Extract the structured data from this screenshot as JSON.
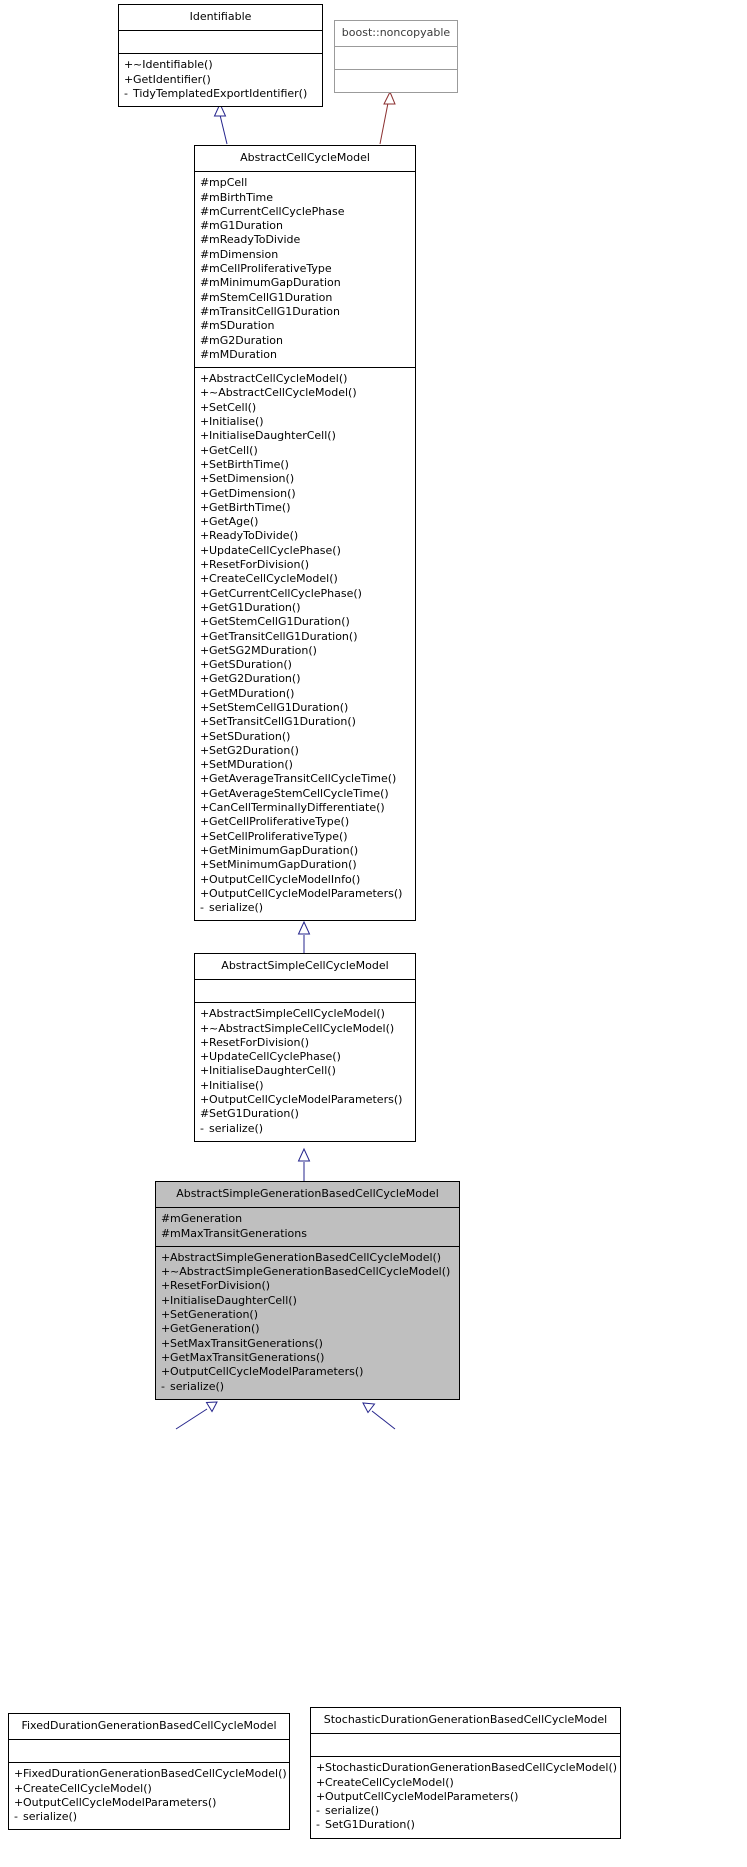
{
  "diagram": {
    "type": "uml-class-inheritance",
    "title": "AbstractSimpleGenerationBasedCellCycleModel inheritance diagram",
    "colors": {
      "highlight_fill": "#bfbfbf",
      "box_border": "#000000",
      "faded_border": "#9b9b9b",
      "inherit_edge": "#25258c",
      "external_edge": "#8b2f2f",
      "background": "#ffffff"
    }
  },
  "classes": {
    "identifiable": {
      "name": "Identifiable",
      "attributes": [],
      "methods": [
        {
          "vis": "+",
          "text": "~Identifiable()"
        },
        {
          "vis": "+",
          "text": "GetIdentifier()"
        },
        {
          "vis": "-",
          "text": "TidyTemplatedExportIdentifier()"
        }
      ]
    },
    "noncopyable": {
      "name": "boost::noncopyable",
      "attributes": [],
      "methods": []
    },
    "abstract_cell_cycle_model": {
      "name": "AbstractCellCycleModel",
      "attributes": [
        {
          "vis": "#",
          "text": "mpCell"
        },
        {
          "vis": "#",
          "text": "mBirthTime"
        },
        {
          "vis": "#",
          "text": "mCurrentCellCyclePhase"
        },
        {
          "vis": "#",
          "text": "mG1Duration"
        },
        {
          "vis": "#",
          "text": "mReadyToDivide"
        },
        {
          "vis": "#",
          "text": "mDimension"
        },
        {
          "vis": "#",
          "text": "mCellProliferativeType"
        },
        {
          "vis": "#",
          "text": "mMinimumGapDuration"
        },
        {
          "vis": "#",
          "text": "mStemCellG1Duration"
        },
        {
          "vis": "#",
          "text": "mTransitCellG1Duration"
        },
        {
          "vis": "#",
          "text": "mSDuration"
        },
        {
          "vis": "#",
          "text": "mG2Duration"
        },
        {
          "vis": "#",
          "text": "mMDuration"
        }
      ],
      "methods": [
        {
          "vis": "+",
          "text": "AbstractCellCycleModel()"
        },
        {
          "vis": "+",
          "text": "~AbstractCellCycleModel()"
        },
        {
          "vis": "+",
          "text": "SetCell()"
        },
        {
          "vis": "+",
          "text": "Initialise()"
        },
        {
          "vis": "+",
          "text": "InitialiseDaughterCell()"
        },
        {
          "vis": "+",
          "text": "GetCell()"
        },
        {
          "vis": "+",
          "text": "SetBirthTime()"
        },
        {
          "vis": "+",
          "text": "SetDimension()"
        },
        {
          "vis": "+",
          "text": "GetDimension()"
        },
        {
          "vis": "+",
          "text": "GetBirthTime()"
        },
        {
          "vis": "+",
          "text": "GetAge()"
        },
        {
          "vis": "+",
          "text": "ReadyToDivide()"
        },
        {
          "vis": "+",
          "text": "UpdateCellCyclePhase()"
        },
        {
          "vis": "+",
          "text": "ResetForDivision()"
        },
        {
          "vis": "+",
          "text": "CreateCellCycleModel()"
        },
        {
          "vis": "+",
          "text": "GetCurrentCellCyclePhase()"
        },
        {
          "vis": "+",
          "text": "GetG1Duration()"
        },
        {
          "vis": "+",
          "text": "GetStemCellG1Duration()"
        },
        {
          "vis": "+",
          "text": "GetTransitCellG1Duration()"
        },
        {
          "vis": "+",
          "text": "GetSG2MDuration()"
        },
        {
          "vis": "+",
          "text": "GetSDuration()"
        },
        {
          "vis": "+",
          "text": "GetG2Duration()"
        },
        {
          "vis": "+",
          "text": "GetMDuration()"
        },
        {
          "vis": "+",
          "text": "SetStemCellG1Duration()"
        },
        {
          "vis": "+",
          "text": "SetTransitCellG1Duration()"
        },
        {
          "vis": "+",
          "text": "SetSDuration()"
        },
        {
          "vis": "+",
          "text": "SetG2Duration()"
        },
        {
          "vis": "+",
          "text": "SetMDuration()"
        },
        {
          "vis": "+",
          "text": "GetAverageTransitCellCycleTime()"
        },
        {
          "vis": "+",
          "text": "GetAverageStemCellCycleTime()"
        },
        {
          "vis": "+",
          "text": "CanCellTerminallyDifferentiate()"
        },
        {
          "vis": "+",
          "text": "GetCellProliferativeType()"
        },
        {
          "vis": "+",
          "text": "SetCellProliferativeType()"
        },
        {
          "vis": "+",
          "text": "GetMinimumGapDuration()"
        },
        {
          "vis": "+",
          "text": "SetMinimumGapDuration()"
        },
        {
          "vis": "+",
          "text": "OutputCellCycleModelInfo()"
        },
        {
          "vis": "+",
          "text": "OutputCellCycleModelParameters()"
        },
        {
          "vis": "-",
          "text": "serialize()"
        }
      ]
    },
    "abstract_simple_cell_cycle_model": {
      "name": "AbstractSimpleCellCycleModel",
      "attributes": [],
      "methods": [
        {
          "vis": "+",
          "text": "AbstractSimpleCellCycleModel()"
        },
        {
          "vis": "+",
          "text": "~AbstractSimpleCellCycleModel()"
        },
        {
          "vis": "+",
          "text": "ResetForDivision()"
        },
        {
          "vis": "+",
          "text": "UpdateCellCyclePhase()"
        },
        {
          "vis": "+",
          "text": "InitialiseDaughterCell()"
        },
        {
          "vis": "+",
          "text": "Initialise()"
        },
        {
          "vis": "+",
          "text": "OutputCellCycleModelParameters()"
        },
        {
          "vis": "#",
          "text": "SetG1Duration()"
        },
        {
          "vis": "-",
          "text": "serialize()"
        }
      ]
    },
    "abstract_simple_generation_based_cell_cycle_model": {
      "name": "AbstractSimpleGenerationBasedCellCycleModel",
      "attributes": [
        {
          "vis": "#",
          "text": "mGeneration"
        },
        {
          "vis": "#",
          "text": "mMaxTransitGenerations"
        }
      ],
      "methods": [
        {
          "vis": "+",
          "text": "AbstractSimpleGenerationBasedCellCycleModel()"
        },
        {
          "vis": "+",
          "text": "~AbstractSimpleGenerationBasedCellCycleModel()"
        },
        {
          "vis": "+",
          "text": "ResetForDivision()"
        },
        {
          "vis": "+",
          "text": "InitialiseDaughterCell()"
        },
        {
          "vis": "+",
          "text": "SetGeneration()"
        },
        {
          "vis": "+",
          "text": "GetGeneration()"
        },
        {
          "vis": "+",
          "text": "SetMaxTransitGenerations()"
        },
        {
          "vis": "+",
          "text": "GetMaxTransitGenerations()"
        },
        {
          "vis": "+",
          "text": "OutputCellCycleModelParameters()"
        },
        {
          "vis": "-",
          "text": "serialize()"
        }
      ]
    },
    "fixed_duration": {
      "name": "FixedDurationGenerationBasedCellCycleModel",
      "attributes": [],
      "methods": [
        {
          "vis": "+",
          "text": "FixedDurationGenerationBasedCellCycleModel()"
        },
        {
          "vis": "+",
          "text": "CreateCellCycleModel()"
        },
        {
          "vis": "+",
          "text": "OutputCellCycleModelParameters()"
        },
        {
          "vis": "-",
          "text": "serialize()"
        }
      ]
    },
    "stochastic_duration": {
      "name": "StochasticDurationGenerationBasedCellCycleModel",
      "attributes": [],
      "methods": [
        {
          "vis": "+",
          "text": "StochasticDurationGenerationBasedCellCycleModel()"
        },
        {
          "vis": "+",
          "text": "CreateCellCycleModel()"
        },
        {
          "vis": "+",
          "text": "OutputCellCycleModelParameters()"
        },
        {
          "vis": "-",
          "text": "serialize()"
        },
        {
          "vis": "-",
          "text": "SetG1Duration()"
        }
      ]
    }
  },
  "edges": [
    {
      "from": "abstract_cell_cycle_model",
      "to": "identifiable",
      "kind": "inheritance"
    },
    {
      "from": "abstract_cell_cycle_model",
      "to": "noncopyable",
      "kind": "inheritance-external"
    },
    {
      "from": "abstract_simple_cell_cycle_model",
      "to": "abstract_cell_cycle_model",
      "kind": "inheritance"
    },
    {
      "from": "abstract_simple_generation_based_cell_cycle_model",
      "to": "abstract_simple_cell_cycle_model",
      "kind": "inheritance"
    },
    {
      "from": "fixed_duration",
      "to": "abstract_simple_generation_based_cell_cycle_model",
      "kind": "inheritance"
    },
    {
      "from": "stochastic_duration",
      "to": "abstract_simple_generation_based_cell_cycle_model",
      "kind": "inheritance"
    }
  ]
}
